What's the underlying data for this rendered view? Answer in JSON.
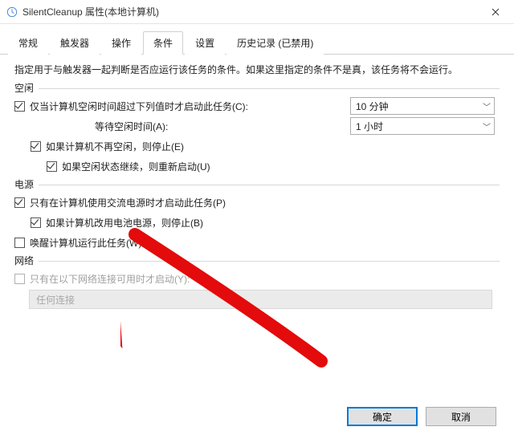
{
  "window": {
    "title": "SilentCleanup 属性(本地计算机)"
  },
  "tabs": {
    "general": "常规",
    "triggers": "触发器",
    "actions": "操作",
    "conditions": "条件",
    "settings": "设置",
    "history": "历史记录 (已禁用)"
  },
  "desc": "指定用于与触发器一起判断是否应运行该任务的条件。如果这里指定的条件不是真，该任务将不会运行。",
  "group_idle": "空闲",
  "idle_start_cb": "仅当计算机空闲时间超过下列值时才启动此任务(C):",
  "idle_timeout_val": "10 分钟",
  "idle_wait_label": "等待空闲时间(A):",
  "idle_wait_val": "1 小时",
  "idle_stop_cb": "如果计算机不再空闲，则停止(E)",
  "idle_restart_cb": "如果空闲状态继续，则重新启动(U)",
  "group_power": "电源",
  "power_ac_cb": "只有在计算机使用交流电源时才启动此任务(P)",
  "power_battery_cb": "如果计算机改用电池电源，则停止(B)",
  "power_wake_cb": "唤醒计算机运行此任务(W)",
  "group_network": "网络",
  "network_cb": "只有在以下网络连接可用时才启动(Y):",
  "network_val": "任何连接",
  "buttons": {
    "ok": "确定",
    "cancel": "取消"
  }
}
